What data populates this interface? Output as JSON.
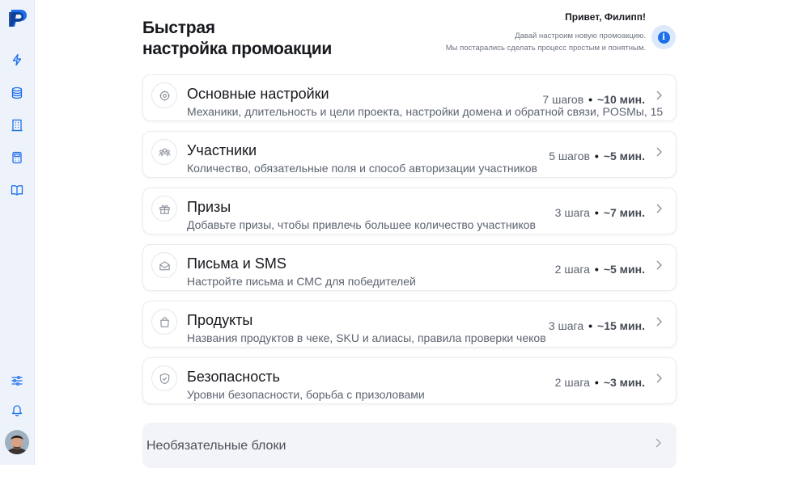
{
  "sidebar": {
    "logo_letter": "P",
    "nav": [
      {
        "icon": "lightning-icon"
      },
      {
        "icon": "database-icon"
      },
      {
        "icon": "building-icon"
      },
      {
        "icon": "calculator-icon"
      },
      {
        "icon": "book-icon"
      }
    ],
    "bottom": [
      {
        "icon": "sliders-icon"
      },
      {
        "icon": "bell-icon"
      }
    ]
  },
  "header": {
    "title_line1": "Быстрая",
    "title_line2": "настройка промоакции",
    "greeting": "Привет, Филипп!",
    "sub_line1": "Давай настроим новую промоакцию.",
    "sub_line2": "Мы постарались сделать процесс простым и понятным.",
    "info_glyph": "i"
  },
  "sections": [
    {
      "icon": "settings-icon",
      "title": "Основные настройки",
      "desc": "Механики, длительность и цели проекта, настройки домена и обратной связи, POSMы, 15",
      "steps": "7 шагов",
      "sep": "•",
      "time": "~10 мин."
    },
    {
      "icon": "users-icon",
      "title": "Участники",
      "desc": "Количество, обязательные поля и способ авторизации участников",
      "steps": "5 шагов",
      "sep": "•",
      "time": "~5 мин."
    },
    {
      "icon": "gift-icon",
      "title": "Призы",
      "desc": "Добавьте призы, чтобы привлечь большее количество участников",
      "steps": "3 шага",
      "sep": "•",
      "time": "~7 мин."
    },
    {
      "icon": "mail-icon",
      "title": "Письма и SMS",
      "desc": "Настройте письма и СМС для победителей",
      "steps": "2 шага",
      "sep": "•",
      "time": "~5 мин."
    },
    {
      "icon": "shopping-bag-icon",
      "title": "Продукты",
      "desc": "Названия продуктов в чеке, SKU и алиасы, правила проверки чеков",
      "steps": "3 шага",
      "sep": "•",
      "time": "~15 мин."
    },
    {
      "icon": "shield-icon",
      "title": "Безопасность",
      "desc": "Уровни безопасности, борьба с призоловами",
      "steps": "2 шага",
      "sep": "•",
      "time": "~3 мин."
    }
  ],
  "optional": {
    "label": "Необязательные блоки"
  },
  "colors": {
    "accent": "#1e6fe8",
    "sidebar_bg": "#eef3fb",
    "muted_text": "#5c6370"
  }
}
